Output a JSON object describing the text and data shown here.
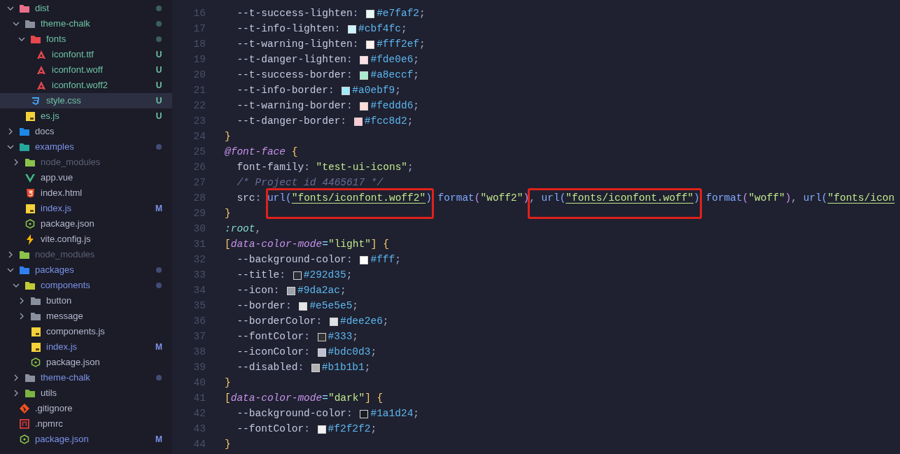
{
  "explorer": {
    "items": [
      {
        "name": "dist",
        "kind": "folder",
        "expanded": true,
        "color": "#6fc2a4",
        "dot": true,
        "selected": false,
        "children": [
          {
            "name": "theme-chalk",
            "kind": "folder",
            "expanded": true,
            "color": "#6fc2a4",
            "dot": true,
            "selected": false,
            "children": [
              {
                "name": "fonts",
                "kind": "folder",
                "expanded": true,
                "color": "#6fc2a4",
                "dot": true,
                "selected": false,
                "children": [
                  {
                    "name": "iconfont.ttf",
                    "kind": "file",
                    "color": "#6fc2a4",
                    "badge": "U",
                    "selected": false
                  },
                  {
                    "name": "iconfont.woff",
                    "kind": "file",
                    "color": "#6fc2a4",
                    "badge": "U",
                    "selected": false
                  },
                  {
                    "name": "iconfont.woff2",
                    "kind": "file",
                    "color": "#6fc2a4",
                    "badge": "U",
                    "selected": false
                  }
                ]
              },
              {
                "name": "style.css",
                "kind": "file",
                "color": "#6fc2a4",
                "badge": "U",
                "selected": true
              }
            ]
          },
          {
            "name": "es.js",
            "kind": "file",
            "color": "#6fc2a4",
            "badge": "U",
            "selected": false
          }
        ]
      },
      {
        "name": "docs",
        "kind": "folder",
        "expanded": false,
        "color": "#b4b8cc",
        "selected": false
      },
      {
        "name": "examples",
        "kind": "folder",
        "expanded": true,
        "color": "#7c93e8",
        "dot": true,
        "selected": false,
        "children": [
          {
            "name": "node_modules",
            "kind": "folder",
            "expanded": false,
            "color": "#5c6075",
            "selected": false
          },
          {
            "name": "app.vue",
            "kind": "file",
            "color": "#b4b8cc",
            "selected": false
          },
          {
            "name": "index.html",
            "kind": "file",
            "color": "#b4b8cc",
            "selected": false
          },
          {
            "name": "index.js",
            "kind": "file",
            "color": "#7c93e8",
            "badge": "M",
            "selected": false
          },
          {
            "name": "package.json",
            "kind": "file",
            "color": "#b4b8cc",
            "selected": false
          },
          {
            "name": "vite.config.js",
            "kind": "file",
            "color": "#b4b8cc",
            "selected": false
          }
        ]
      },
      {
        "name": "node_modules",
        "kind": "folder",
        "expanded": false,
        "color": "#5c6075",
        "selected": false
      },
      {
        "name": "packages",
        "kind": "folder",
        "expanded": true,
        "color": "#7c93e8",
        "dot": true,
        "selected": false,
        "children": [
          {
            "name": "components",
            "kind": "folder",
            "expanded": true,
            "color": "#7c93e8",
            "dot": true,
            "selected": false,
            "children": [
              {
                "name": "button",
                "kind": "folder",
                "expanded": false,
                "color": "#b4b8cc",
                "selected": false
              },
              {
                "name": "message",
                "kind": "folder",
                "expanded": false,
                "color": "#b4b8cc",
                "selected": false
              },
              {
                "name": "components.js",
                "kind": "file",
                "color": "#b4b8cc",
                "selected": false
              },
              {
                "name": "index.js",
                "kind": "file",
                "color": "#7c93e8",
                "badge": "M",
                "selected": false
              },
              {
                "name": "package.json",
                "kind": "file",
                "color": "#b4b8cc",
                "selected": false
              }
            ]
          },
          {
            "name": "theme-chalk",
            "kind": "folder",
            "expanded": false,
            "color": "#7c93e8",
            "dot": true,
            "selected": false
          },
          {
            "name": "utils",
            "kind": "folder",
            "expanded": false,
            "color": "#b4b8cc",
            "selected": false
          }
        ]
      },
      {
        "name": ".gitignore",
        "kind": "file",
        "color": "#b4b8cc",
        "selected": false
      },
      {
        "name": ".npmrc",
        "kind": "file",
        "color": "#b4b8cc",
        "selected": false
      },
      {
        "name": "package.json",
        "kind": "file",
        "color": "#7c93e8",
        "badge": "M",
        "selected": false
      }
    ]
  },
  "editor": {
    "lines": [
      {
        "number": "16",
        "tokens": [
          {
            "kind": "prop",
            "text": "  --t-success-lighten"
          },
          {
            "kind": "punct",
            "text": ": "
          },
          {
            "kind": "swatch",
            "color": "#e7faf2"
          },
          {
            "kind": "hex",
            "text": "#e7faf2"
          },
          {
            "kind": "punct",
            "text": ";"
          }
        ]
      },
      {
        "number": "17",
        "tokens": [
          {
            "kind": "prop",
            "text": "  --t-info-lighten"
          },
          {
            "kind": "punct",
            "text": ": "
          },
          {
            "kind": "swatch",
            "color": "#cbf4fc"
          },
          {
            "kind": "hex",
            "text": "#cbf4fc"
          },
          {
            "kind": "punct",
            "text": ";"
          }
        ]
      },
      {
        "number": "18",
        "tokens": [
          {
            "kind": "prop",
            "text": "  --t-warning-lighten"
          },
          {
            "kind": "punct",
            "text": ": "
          },
          {
            "kind": "swatch",
            "color": "#fff2ef"
          },
          {
            "kind": "hex",
            "text": "#fff2ef"
          },
          {
            "kind": "punct",
            "text": ";"
          }
        ]
      },
      {
        "number": "19",
        "tokens": [
          {
            "kind": "prop",
            "text": "  --t-danger-lighten"
          },
          {
            "kind": "punct",
            "text": ": "
          },
          {
            "kind": "swatch",
            "color": "#fde0e6"
          },
          {
            "kind": "hex",
            "text": "#fde0e6"
          },
          {
            "kind": "punct",
            "text": ";"
          }
        ]
      },
      {
        "number": "20",
        "tokens": [
          {
            "kind": "prop",
            "text": "  --t-success-border"
          },
          {
            "kind": "punct",
            "text": ": "
          },
          {
            "kind": "swatch",
            "color": "#a8eccf"
          },
          {
            "kind": "hex",
            "text": "#a8eccf"
          },
          {
            "kind": "punct",
            "text": ";"
          }
        ]
      },
      {
        "number": "21",
        "tokens": [
          {
            "kind": "prop",
            "text": "  --t-info-border"
          },
          {
            "kind": "punct",
            "text": ": "
          },
          {
            "kind": "swatch",
            "color": "#a0ebf9"
          },
          {
            "kind": "hex",
            "text": "#a0ebf9"
          },
          {
            "kind": "punct",
            "text": ";"
          }
        ]
      },
      {
        "number": "22",
        "tokens": [
          {
            "kind": "prop",
            "text": "  --t-warning-border"
          },
          {
            "kind": "punct",
            "text": ": "
          },
          {
            "kind": "swatch",
            "color": "#feddd6"
          },
          {
            "kind": "hex",
            "text": "#feddd6"
          },
          {
            "kind": "punct",
            "text": ";"
          }
        ]
      },
      {
        "number": "23",
        "tokens": [
          {
            "kind": "prop",
            "text": "  --t-danger-border"
          },
          {
            "kind": "punct",
            "text": ": "
          },
          {
            "kind": "swatch",
            "color": "#fcc8d2"
          },
          {
            "kind": "hex",
            "text": "#fcc8d2"
          },
          {
            "kind": "punct",
            "text": ";"
          }
        ]
      },
      {
        "number": "24",
        "tokens": [
          {
            "kind": "brace",
            "text": "}"
          }
        ]
      },
      {
        "number": "25",
        "tokens": [
          {
            "kind": "atrule",
            "text": "@font-face"
          },
          {
            "kind": "brace",
            "text": " {"
          }
        ]
      },
      {
        "number": "26",
        "tokens": [
          {
            "kind": "prop",
            "text": "  font-family"
          },
          {
            "kind": "punct",
            "text": ": "
          },
          {
            "kind": "string",
            "text": "\"test-ui-icons\""
          },
          {
            "kind": "punct",
            "text": ";"
          }
        ]
      },
      {
        "number": "27",
        "tokens": [
          {
            "kind": "comment",
            "text": "  /* Project id 4465617 */"
          }
        ]
      },
      {
        "number": "28",
        "tokens": [
          {
            "kind": "prop",
            "text": "  src"
          },
          {
            "kind": "punct",
            "text": ": "
          },
          {
            "kind": "func",
            "text": "url(",
            "boxed": true
          },
          {
            "kind": "link",
            "text": "\"fonts/iconfont.woff2\"",
            "boxed": true
          },
          {
            "kind": "func",
            "text": ")",
            "boxed": true
          },
          {
            "kind": "func",
            "text": " format"
          },
          {
            "kind": "paren",
            "text": "("
          },
          {
            "kind": "string",
            "text": "\"woff2\""
          },
          {
            "kind": "paren",
            "text": ")"
          },
          {
            "kind": "punct",
            "text": ", ",
            "boxed": true
          },
          {
            "kind": "func",
            "text": "url(",
            "boxed": true
          },
          {
            "kind": "link",
            "text": "\"fonts/iconfont.woff\"",
            "boxed": true
          },
          {
            "kind": "func",
            "text": ")",
            "boxed": true
          },
          {
            "kind": "func",
            "text": " format"
          },
          {
            "kind": "paren",
            "text": "("
          },
          {
            "kind": "string",
            "text": "\"woff\""
          },
          {
            "kind": "paren",
            "text": ")"
          },
          {
            "kind": "punct",
            "text": ", "
          },
          {
            "kind": "func",
            "text": "url("
          },
          {
            "kind": "link",
            "text": "\"fonts/icon"
          }
        ]
      },
      {
        "number": "29",
        "tokens": [
          {
            "kind": "brace",
            "text": "}"
          }
        ]
      },
      {
        "number": "30",
        "tokens": [
          {
            "kind": "selector",
            "text": ":root"
          },
          {
            "kind": "punct",
            "text": ","
          }
        ]
      },
      {
        "number": "31",
        "tokens": [
          {
            "kind": "brace",
            "text": "["
          },
          {
            "kind": "attr",
            "text": "data-color-mode"
          },
          {
            "kind": "op",
            "text": "="
          },
          {
            "kind": "string",
            "text": "\"light\""
          },
          {
            "kind": "brace",
            "text": "] {"
          }
        ]
      },
      {
        "number": "32",
        "tokens": [
          {
            "kind": "prop",
            "text": "  --background-color"
          },
          {
            "kind": "punct",
            "text": ": "
          },
          {
            "kind": "swatch",
            "color": "#ffffff"
          },
          {
            "kind": "hex",
            "text": "#fff"
          },
          {
            "kind": "punct",
            "text": ";"
          }
        ]
      },
      {
        "number": "33",
        "tokens": [
          {
            "kind": "prop",
            "text": "  --title"
          },
          {
            "kind": "punct",
            "text": ": "
          },
          {
            "kind": "swatch",
            "color": "#292d35"
          },
          {
            "kind": "hex",
            "text": "#292d35"
          },
          {
            "kind": "punct",
            "text": ";"
          }
        ]
      },
      {
        "number": "34",
        "tokens": [
          {
            "kind": "prop",
            "text": "  --icon"
          },
          {
            "kind": "punct",
            "text": ": "
          },
          {
            "kind": "swatch",
            "color": "#9da2ac"
          },
          {
            "kind": "hex",
            "text": "#9da2ac"
          },
          {
            "kind": "punct",
            "text": ";"
          }
        ]
      },
      {
        "number": "35",
        "tokens": [
          {
            "kind": "prop",
            "text": "  --border"
          },
          {
            "kind": "punct",
            "text": ": "
          },
          {
            "kind": "swatch",
            "color": "#e5e5e5"
          },
          {
            "kind": "hex",
            "text": "#e5e5e5"
          },
          {
            "kind": "punct",
            "text": ";"
          }
        ]
      },
      {
        "number": "36",
        "tokens": [
          {
            "kind": "prop",
            "text": "  --borderColor"
          },
          {
            "kind": "punct",
            "text": ": "
          },
          {
            "kind": "swatch",
            "color": "#dee2e6"
          },
          {
            "kind": "hex",
            "text": "#dee2e6"
          },
          {
            "kind": "punct",
            "text": ";"
          }
        ]
      },
      {
        "number": "37",
        "tokens": [
          {
            "kind": "prop",
            "text": "  --fontColor"
          },
          {
            "kind": "punct",
            "text": ": "
          },
          {
            "kind": "swatch",
            "color": "#333333"
          },
          {
            "kind": "hex",
            "text": "#333"
          },
          {
            "kind": "punct",
            "text": ";"
          }
        ]
      },
      {
        "number": "38",
        "tokens": [
          {
            "kind": "prop",
            "text": "  --iconColor"
          },
          {
            "kind": "punct",
            "text": ": "
          },
          {
            "kind": "swatch",
            "color": "#bdc0d3"
          },
          {
            "kind": "hex",
            "text": "#bdc0d3"
          },
          {
            "kind": "punct",
            "text": ";"
          }
        ]
      },
      {
        "number": "39",
        "tokens": [
          {
            "kind": "prop",
            "text": "  --disabled"
          },
          {
            "kind": "punct",
            "text": ": "
          },
          {
            "kind": "swatch",
            "color": "#b1b1b1"
          },
          {
            "kind": "hex",
            "text": "#b1b1b1"
          },
          {
            "kind": "punct",
            "text": ";"
          }
        ]
      },
      {
        "number": "40",
        "tokens": [
          {
            "kind": "brace",
            "text": "}"
          }
        ]
      },
      {
        "number": "41",
        "tokens": [
          {
            "kind": "brace",
            "text": "["
          },
          {
            "kind": "attr",
            "text": "data-color-mode"
          },
          {
            "kind": "op",
            "text": "="
          },
          {
            "kind": "string",
            "text": "\"dark\""
          },
          {
            "kind": "brace",
            "text": "] {"
          }
        ]
      },
      {
        "number": "42",
        "tokens": [
          {
            "kind": "prop",
            "text": "  --background-color"
          },
          {
            "kind": "punct",
            "text": ": "
          },
          {
            "kind": "swatch",
            "color": "#1a1d24"
          },
          {
            "kind": "hex",
            "text": "#1a1d24"
          },
          {
            "kind": "punct",
            "text": ";"
          }
        ]
      },
      {
        "number": "43",
        "tokens": [
          {
            "kind": "prop",
            "text": "  --fontColor"
          },
          {
            "kind": "punct",
            "text": ": "
          },
          {
            "kind": "swatch",
            "color": "#f2f2f2"
          },
          {
            "kind": "hex",
            "text": "#f2f2f2"
          },
          {
            "kind": "punct",
            "text": ";"
          }
        ]
      },
      {
        "number": "44",
        "tokens": [
          {
            "kind": "brace",
            "text": "}"
          }
        ]
      }
    ]
  }
}
